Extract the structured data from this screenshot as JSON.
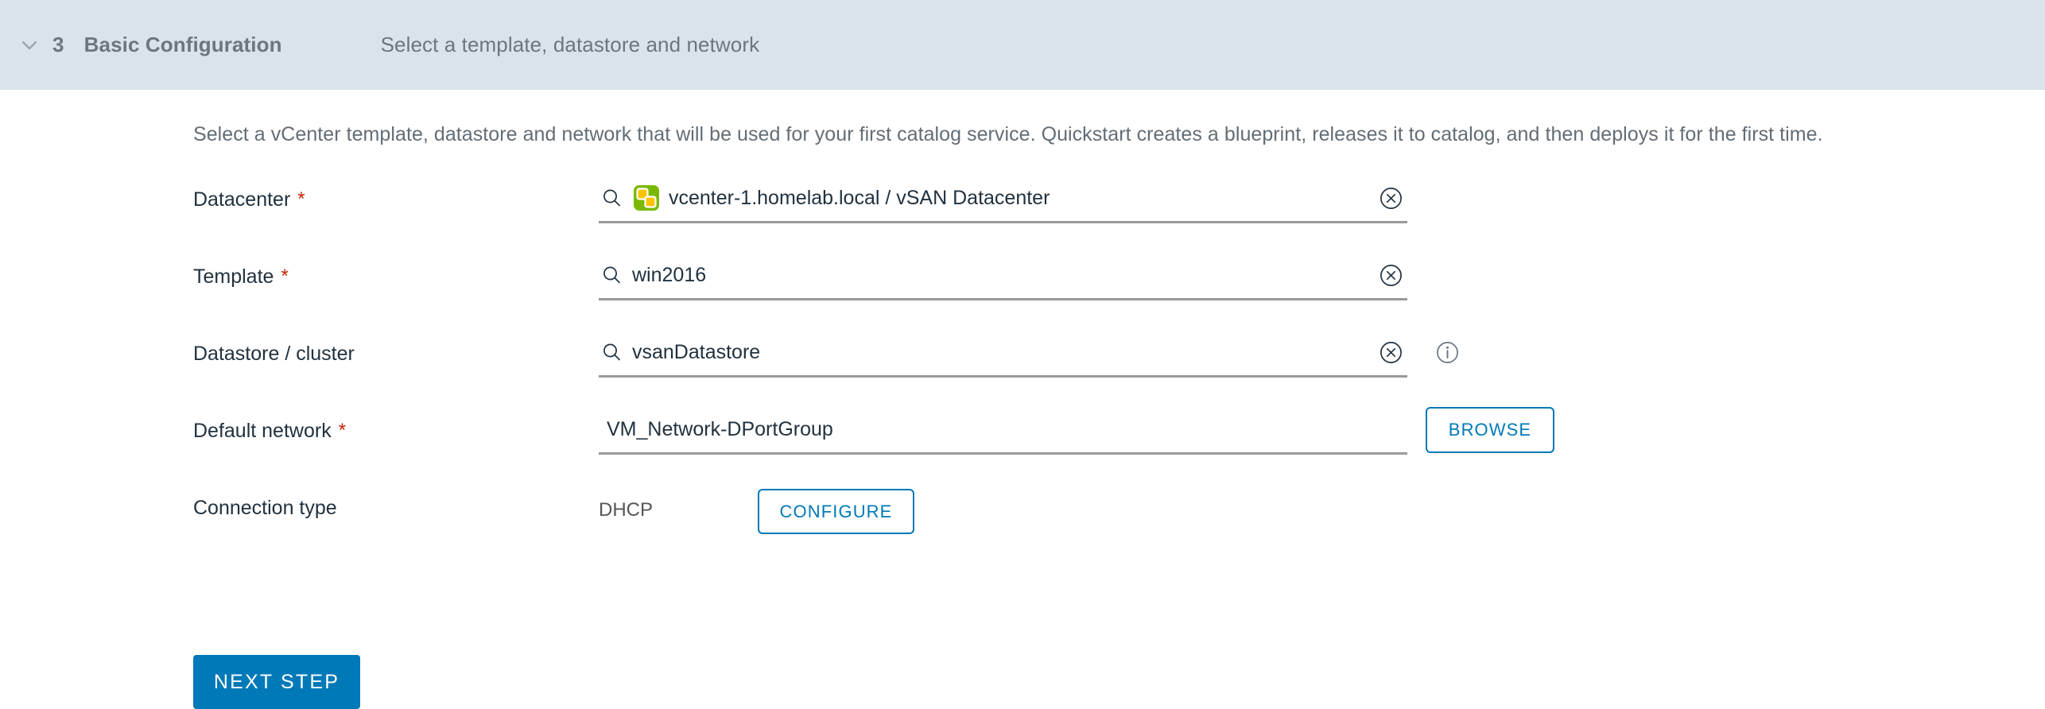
{
  "step_header": {
    "chevron_icon": "chevron-down-icon",
    "number": "3",
    "title": "Basic Configuration",
    "subtitle": "Select a template, datastore and network"
  },
  "description": "Select a vCenter template, datastore and network that will be used for your first catalog service. Quickstart creates a blueprint, releases it to catalog, and then deploys it for the first time.",
  "required_marker": "*",
  "fields": [
    {
      "label": "Datacenter",
      "required": true,
      "value": "vcenter-1.homelab.local / vSAN Datacenter",
      "placeholder": "",
      "search_icon": "search-icon",
      "prefix_icon": "vsphere-datacenter-icon",
      "clear_icon": "clear-circle-icon",
      "info_icon": null
    },
    {
      "label": "Template",
      "required": true,
      "value": "win2016",
      "placeholder": "",
      "search_icon": "search-icon",
      "prefix_icon": null,
      "clear_icon": "clear-circle-icon",
      "info_icon": null
    },
    {
      "label": "Datastore / cluster",
      "required": false,
      "value": "vsanDatastore",
      "placeholder": "",
      "search_icon": "search-icon",
      "prefix_icon": null,
      "clear_icon": "clear-circle-icon",
      "info_icon": "info-circle-icon"
    },
    {
      "label": "Default network",
      "required": true,
      "value": "VM_Network-DPortGroup",
      "placeholder": "",
      "search_icon": null,
      "prefix_icon": null,
      "clear_icon": null,
      "info_icon": null
    }
  ],
  "connection_type": {
    "label": "Connection type",
    "value": "DHCP",
    "configure_label": "CONFIGURE"
  },
  "browse_label": "BROWSE",
  "next_step_label": "NEXT STEP",
  "colors": {
    "header_band": "#dae3e9",
    "header_text": "#6b7680",
    "accent_blue": "#0079b8",
    "required_red": "#c92100",
    "body_text": "#21323f",
    "muted_text": "#636d75",
    "underline": "#9a9a9a",
    "icon_green": "#7ab800",
    "icon_yellow": "#fdc300"
  }
}
